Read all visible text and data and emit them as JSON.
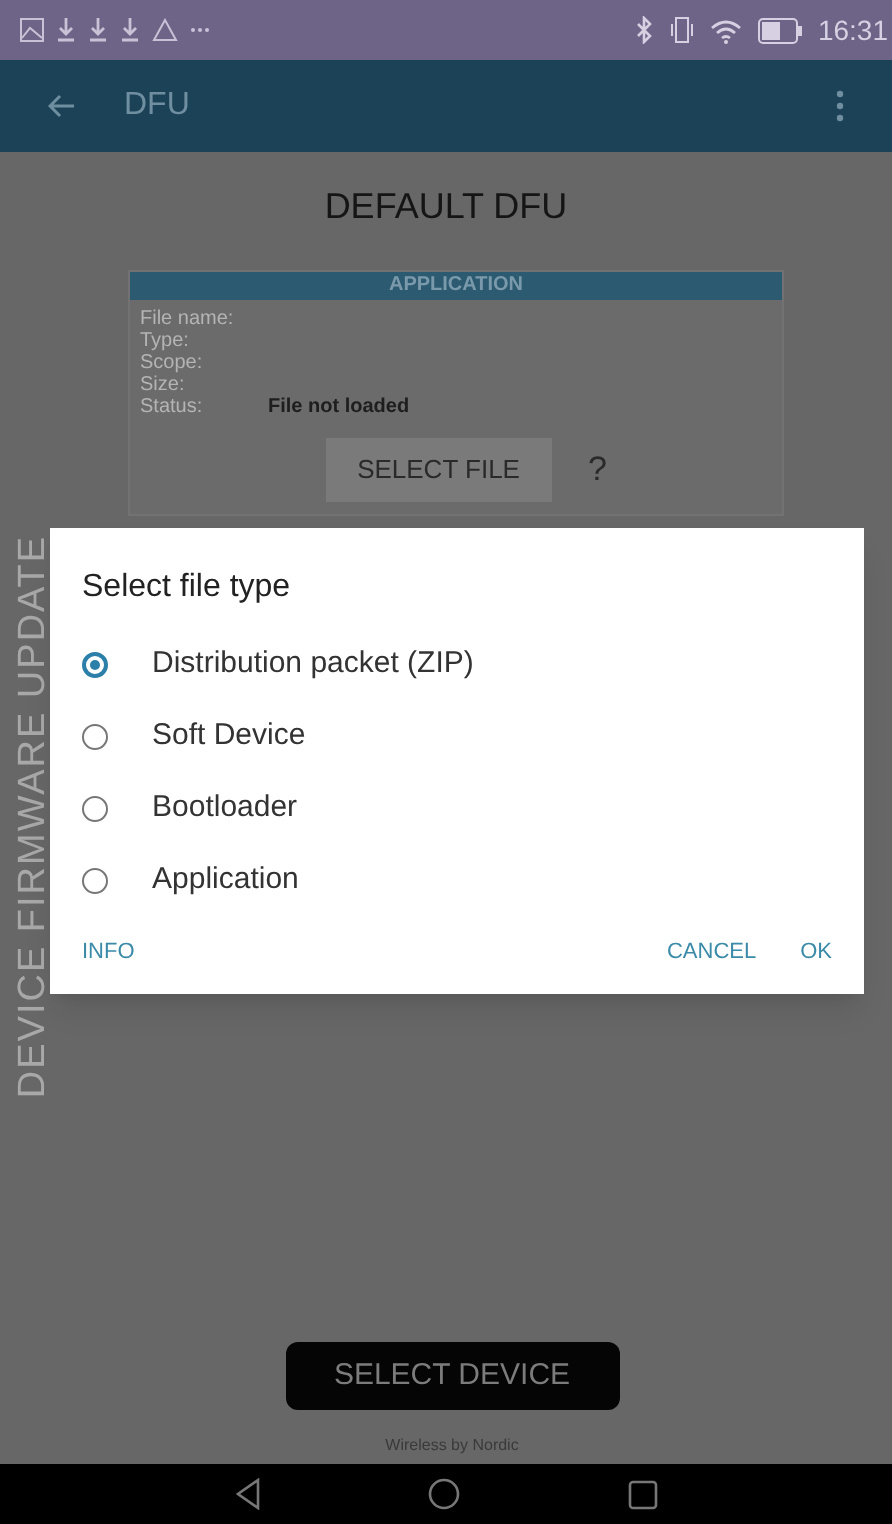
{
  "status_bar": {
    "time": "16:31"
  },
  "app_bar": {
    "title": "DFU"
  },
  "page": {
    "title": "DEFAULT DFU",
    "side_label": "DEVICE FIRMWARE UPDATE"
  },
  "card": {
    "header": "APPLICATION",
    "fields": [
      {
        "label": "File name:"
      },
      {
        "label": "Type:"
      },
      {
        "label": "Scope:"
      },
      {
        "label": "Size:"
      },
      {
        "label": "Status:",
        "value": "File not loaded"
      }
    ],
    "button": "SELECT FILE",
    "help": "?"
  },
  "dialog": {
    "title": "Select file type",
    "options": [
      {
        "label": "Distribution packet (ZIP)",
        "selected": true
      },
      {
        "label": "Soft Device",
        "selected": false
      },
      {
        "label": "Bootloader",
        "selected": false
      },
      {
        "label": "Application",
        "selected": false
      }
    ],
    "info": "INFO",
    "cancel": "CANCEL",
    "ok": "OK"
  },
  "footer": {
    "button": "SELECT DEVICE",
    "credit": "Wireless by Nordic"
  }
}
